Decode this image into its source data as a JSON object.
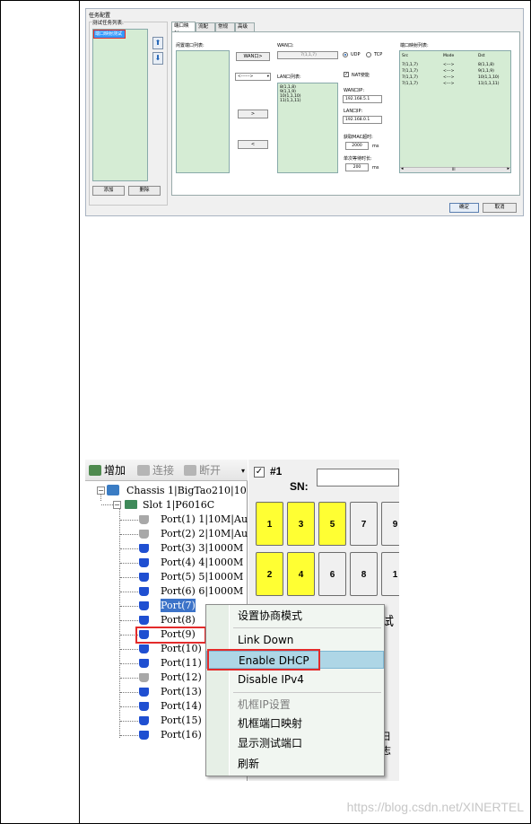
{
  "dialog": {
    "title": "任务配置",
    "task_group_label": "测试任务列表:",
    "task_item": "端口映射测试",
    "add_button": "添加",
    "delete_button": "删除",
    "tabs": [
      "端口映射",
      "流配置",
      "常规",
      "高级"
    ],
    "idle_ports_label": "闲置端口列表:",
    "wan_button": "WAN口>",
    "dir_combo": "<------>",
    "move_right": ">",
    "move_left": "<",
    "wan_port_label": "WAN口:",
    "wan_port_value": "7(1,1,7)",
    "protocol_udp": "UDP",
    "protocol_tcp": "TCP",
    "lan_list_label": "LAN口列表:",
    "lan_items": [
      "8(1,1,8)",
      "9(1,1,9)",
      "10(1,1,10)",
      "11(1,1,11)"
    ],
    "nat_enable_label": "NAT使能",
    "wan_ip_label": "WAN口IP:",
    "wan_ip_value": "192.168.5.1",
    "lan_ip_label": "LAN口IP:",
    "lan_ip_value": "192.168.0.1",
    "mac_timeout_label": "获取MAC超时:",
    "mac_timeout_value": "2000",
    "mac_timeout_unit": "ms",
    "wait_label": "单次等待时长:",
    "wait_value": "200",
    "wait_unit": "ms",
    "mapping_list_label": "端口映射列表:",
    "mapping_headers": [
      "Src",
      "Mode",
      "Dst"
    ],
    "mapping_rows": [
      [
        "7(1,1,7)",
        "<--->",
        "8(1,1,8)"
      ],
      [
        "7(1,1,7)",
        "<--->",
        "9(1,1,9)"
      ],
      [
        "7(1,1,7)",
        "<--->",
        "10(1,1,10)"
      ],
      [
        "7(1,1,7)",
        "<--->",
        "11(1,1,11)"
      ]
    ],
    "scroll_grip": "III",
    "ok_button": "确定",
    "cancel_button": "取消"
  },
  "tree_window": {
    "toolbar": {
      "add_label": "增加",
      "connect_label": "连接",
      "disconnect_label": "断开"
    },
    "chassis_label": "Chassis 1|BigTao210|10",
    "slot_label": "Slot 1|P6016C",
    "ports": [
      {
        "label": "Port(1) 1|10M|Au",
        "color": "gray"
      },
      {
        "label": "Port(2) 2|10M|Au",
        "color": "gray"
      },
      {
        "label": "Port(3) 3|1000M",
        "color": "blue"
      },
      {
        "label": "Port(4) 4|1000M",
        "color": "blue"
      },
      {
        "label": "Port(5) 5|1000M",
        "color": "blue"
      },
      {
        "label": "Port(6) 6|1000M",
        "color": "blue"
      },
      {
        "label": "Port(7)",
        "color": "blue"
      },
      {
        "label": "Port(8)",
        "color": "blue"
      },
      {
        "label": "Port(9)",
        "color": "blue"
      },
      {
        "label": "Port(10)",
        "color": "blue"
      },
      {
        "label": "Port(11)",
        "color": "blue"
      },
      {
        "label": "Port(12)",
        "color": "gray"
      },
      {
        "label": "Port(13)",
        "color": "blue"
      },
      {
        "label": "Port(14)",
        "color": "blue"
      },
      {
        "label": "Port(15)",
        "color": "blue"
      },
      {
        "label": "Port(16)",
        "color": "blue"
      }
    ],
    "check_label": "#1",
    "sn_label": "SN:",
    "port_grid_top": [
      "1",
      "3",
      "5",
      "7",
      "9"
    ],
    "port_grid_bottom": [
      "2",
      "4",
      "6",
      "8",
      "1"
    ],
    "highlighted_ports": [
      "1",
      "3",
      "5",
      "2",
      "4"
    ],
    "partial_right_1": "试",
    "partial_right_2": "日志",
    "context_menu": [
      {
        "label": "设置协商模式",
        "disabled": false
      },
      {
        "label": "Link Down",
        "disabled": false
      },
      {
        "label": "Enable DHCP",
        "disabled": false,
        "highlighted": true
      },
      {
        "label": "Disable IPv4",
        "disabled": false
      },
      {
        "label": "机框IP设置",
        "disabled": true
      },
      {
        "label": "机框端口映射",
        "disabled": false
      },
      {
        "label": "显示测试端口",
        "disabled": false
      },
      {
        "label": "刷新",
        "disabled": false
      }
    ]
  },
  "watermark": "https://blog.csdn.net/XINERTEL",
  "colors": {
    "list_green": "#d5ecd4",
    "highlight_red": "#e32b2b",
    "port_yellow": "#ffff33",
    "menu_highlight": "#aed6e6"
  }
}
